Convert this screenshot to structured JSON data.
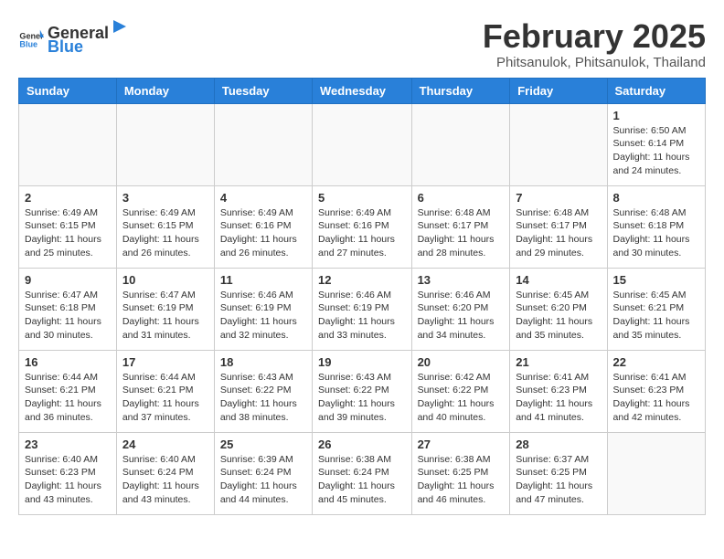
{
  "header": {
    "logo_general": "General",
    "logo_blue": "Blue",
    "month_title": "February 2025",
    "location": "Phitsanulok, Phitsanulok, Thailand"
  },
  "weekdays": [
    "Sunday",
    "Monday",
    "Tuesday",
    "Wednesday",
    "Thursday",
    "Friday",
    "Saturday"
  ],
  "weeks": [
    [
      {
        "day": "",
        "info": ""
      },
      {
        "day": "",
        "info": ""
      },
      {
        "day": "",
        "info": ""
      },
      {
        "day": "",
        "info": ""
      },
      {
        "day": "",
        "info": ""
      },
      {
        "day": "",
        "info": ""
      },
      {
        "day": "1",
        "info": "Sunrise: 6:50 AM\nSunset: 6:14 PM\nDaylight: 11 hours and 24 minutes."
      }
    ],
    [
      {
        "day": "2",
        "info": "Sunrise: 6:49 AM\nSunset: 6:15 PM\nDaylight: 11 hours and 25 minutes."
      },
      {
        "day": "3",
        "info": "Sunrise: 6:49 AM\nSunset: 6:15 PM\nDaylight: 11 hours and 26 minutes."
      },
      {
        "day": "4",
        "info": "Sunrise: 6:49 AM\nSunset: 6:16 PM\nDaylight: 11 hours and 26 minutes."
      },
      {
        "day": "5",
        "info": "Sunrise: 6:49 AM\nSunset: 6:16 PM\nDaylight: 11 hours and 27 minutes."
      },
      {
        "day": "6",
        "info": "Sunrise: 6:48 AM\nSunset: 6:17 PM\nDaylight: 11 hours and 28 minutes."
      },
      {
        "day": "7",
        "info": "Sunrise: 6:48 AM\nSunset: 6:17 PM\nDaylight: 11 hours and 29 minutes."
      },
      {
        "day": "8",
        "info": "Sunrise: 6:48 AM\nSunset: 6:18 PM\nDaylight: 11 hours and 30 minutes."
      }
    ],
    [
      {
        "day": "9",
        "info": "Sunrise: 6:47 AM\nSunset: 6:18 PM\nDaylight: 11 hours and 30 minutes."
      },
      {
        "day": "10",
        "info": "Sunrise: 6:47 AM\nSunset: 6:19 PM\nDaylight: 11 hours and 31 minutes."
      },
      {
        "day": "11",
        "info": "Sunrise: 6:46 AM\nSunset: 6:19 PM\nDaylight: 11 hours and 32 minutes."
      },
      {
        "day": "12",
        "info": "Sunrise: 6:46 AM\nSunset: 6:19 PM\nDaylight: 11 hours and 33 minutes."
      },
      {
        "day": "13",
        "info": "Sunrise: 6:46 AM\nSunset: 6:20 PM\nDaylight: 11 hours and 34 minutes."
      },
      {
        "day": "14",
        "info": "Sunrise: 6:45 AM\nSunset: 6:20 PM\nDaylight: 11 hours and 35 minutes."
      },
      {
        "day": "15",
        "info": "Sunrise: 6:45 AM\nSunset: 6:21 PM\nDaylight: 11 hours and 35 minutes."
      }
    ],
    [
      {
        "day": "16",
        "info": "Sunrise: 6:44 AM\nSunset: 6:21 PM\nDaylight: 11 hours and 36 minutes."
      },
      {
        "day": "17",
        "info": "Sunrise: 6:44 AM\nSunset: 6:21 PM\nDaylight: 11 hours and 37 minutes."
      },
      {
        "day": "18",
        "info": "Sunrise: 6:43 AM\nSunset: 6:22 PM\nDaylight: 11 hours and 38 minutes."
      },
      {
        "day": "19",
        "info": "Sunrise: 6:43 AM\nSunset: 6:22 PM\nDaylight: 11 hours and 39 minutes."
      },
      {
        "day": "20",
        "info": "Sunrise: 6:42 AM\nSunset: 6:22 PM\nDaylight: 11 hours and 40 minutes."
      },
      {
        "day": "21",
        "info": "Sunrise: 6:41 AM\nSunset: 6:23 PM\nDaylight: 11 hours and 41 minutes."
      },
      {
        "day": "22",
        "info": "Sunrise: 6:41 AM\nSunset: 6:23 PM\nDaylight: 11 hours and 42 minutes."
      }
    ],
    [
      {
        "day": "23",
        "info": "Sunrise: 6:40 AM\nSunset: 6:23 PM\nDaylight: 11 hours and 43 minutes."
      },
      {
        "day": "24",
        "info": "Sunrise: 6:40 AM\nSunset: 6:24 PM\nDaylight: 11 hours and 43 minutes."
      },
      {
        "day": "25",
        "info": "Sunrise: 6:39 AM\nSunset: 6:24 PM\nDaylight: 11 hours and 44 minutes."
      },
      {
        "day": "26",
        "info": "Sunrise: 6:38 AM\nSunset: 6:24 PM\nDaylight: 11 hours and 45 minutes."
      },
      {
        "day": "27",
        "info": "Sunrise: 6:38 AM\nSunset: 6:25 PM\nDaylight: 11 hours and 46 minutes."
      },
      {
        "day": "28",
        "info": "Sunrise: 6:37 AM\nSunset: 6:25 PM\nDaylight: 11 hours and 47 minutes."
      },
      {
        "day": "",
        "info": ""
      }
    ]
  ]
}
